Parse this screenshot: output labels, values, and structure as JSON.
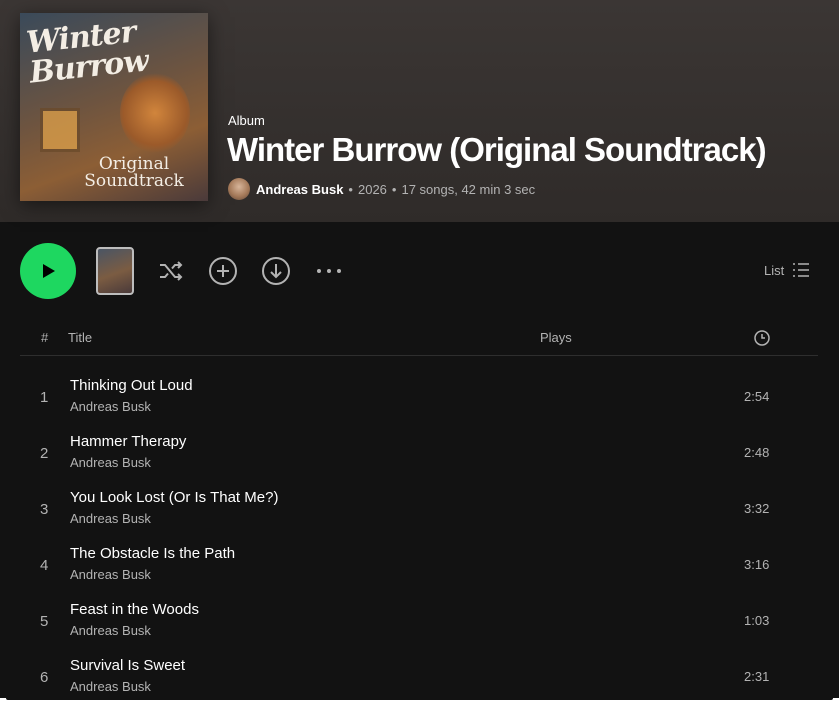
{
  "album": {
    "type_label": "Album",
    "title": "Winter Burrow (Original Soundtrack)",
    "artist": "Andreas Busk",
    "year": "2026",
    "summary": "17 songs, 42 min 3 sec",
    "separator": "•",
    "cover_title": "Winter Burrow",
    "cover_subtitle": "Original Soundtrack"
  },
  "controls": {
    "play_icon": "play-icon",
    "shuffle_icon": "shuffle-icon",
    "add_icon": "add-circle-icon",
    "download_icon": "download-icon",
    "more_icon": "more-dots-icon",
    "view_label": "List",
    "view_icon": "list-icon"
  },
  "table": {
    "col_num": "#",
    "col_title": "Title",
    "col_plays": "Plays",
    "col_duration_icon": "clock-icon"
  },
  "tracks": [
    {
      "num": "1",
      "title": "Thinking Out Loud",
      "artist": "Andreas Busk",
      "duration": "2:54"
    },
    {
      "num": "2",
      "title": "Hammer Therapy",
      "artist": "Andreas Busk",
      "duration": "2:48"
    },
    {
      "num": "3",
      "title": "You Look Lost (Or Is That Me?)",
      "artist": "Andreas Busk",
      "duration": "3:32"
    },
    {
      "num": "4",
      "title": "The Obstacle Is the Path",
      "artist": "Andreas Busk",
      "duration": "3:16"
    },
    {
      "num": "5",
      "title": "Feast in the Woods",
      "artist": "Andreas Busk",
      "duration": "1:03"
    },
    {
      "num": "6",
      "title": "Survival Is Sweet",
      "artist": "Andreas Busk",
      "duration": "2:31"
    }
  ],
  "colors": {
    "accent": "#1ed760",
    "background": "#121212",
    "header": "#3b3634",
    "muted_text": "#b3b3b3"
  }
}
